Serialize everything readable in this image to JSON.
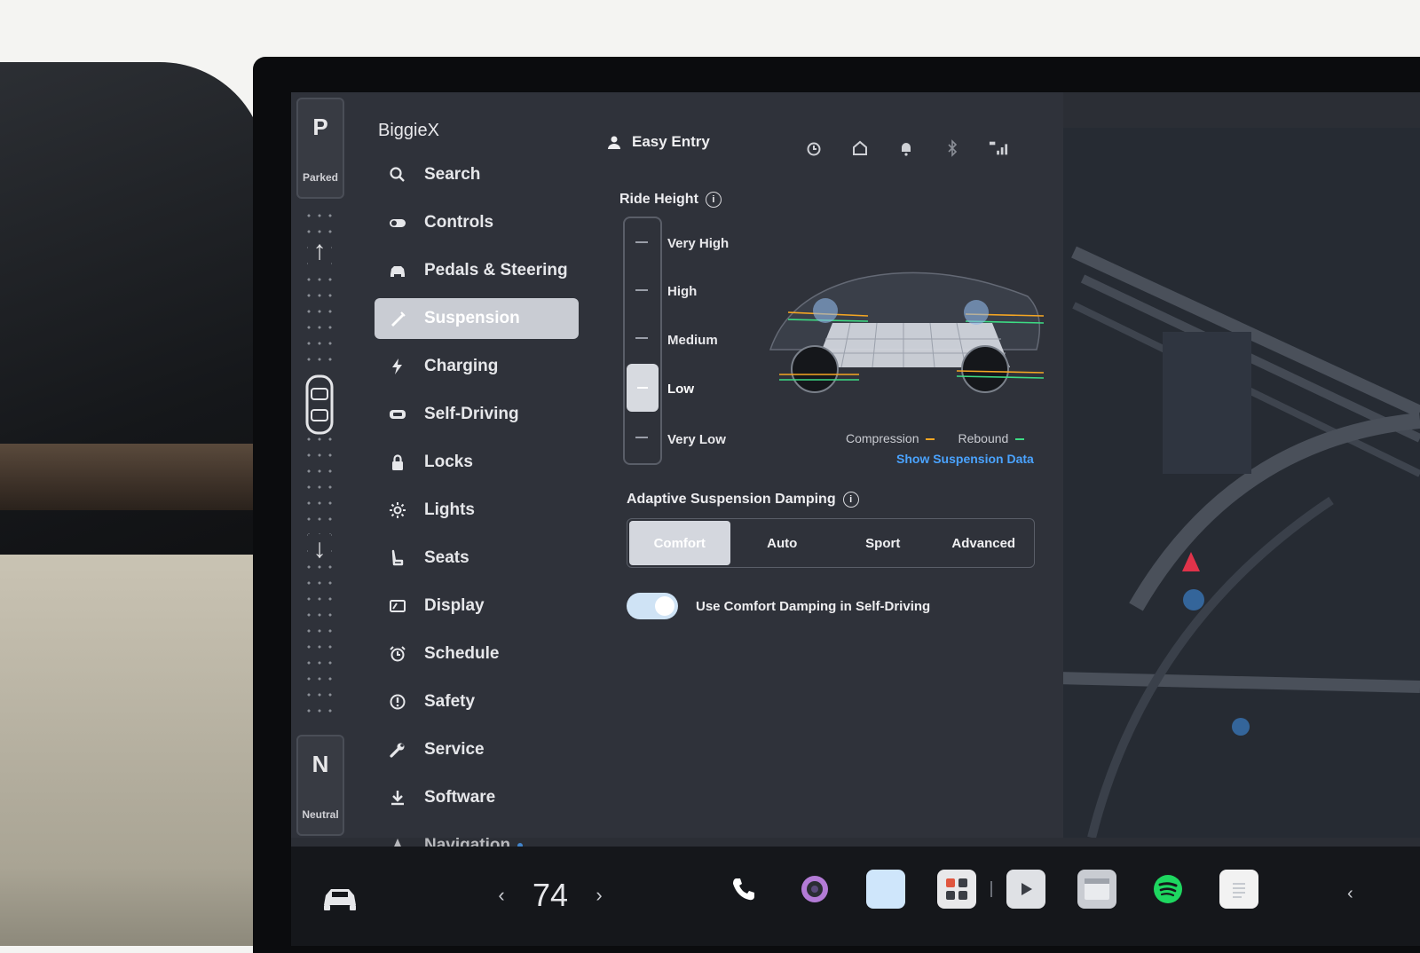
{
  "gear": {
    "park_letter": "P",
    "park_label": "Parked",
    "neutral_letter": "N",
    "neutral_label": "Neutral"
  },
  "profile": {
    "name": "BiggieX",
    "header_profile": "Easy Entry"
  },
  "nav": {
    "items": [
      {
        "label": "Search",
        "icon": "search-icon"
      },
      {
        "label": "Controls",
        "icon": "toggle-icon"
      },
      {
        "label": "Pedals & Steering",
        "icon": "car-icon"
      },
      {
        "label": "Suspension",
        "icon": "suspension-icon",
        "active": true
      },
      {
        "label": "Charging",
        "icon": "lightning-icon"
      },
      {
        "label": "Self-Driving",
        "icon": "steering-wheel-icon"
      },
      {
        "label": "Locks",
        "icon": "lock-icon"
      },
      {
        "label": "Lights",
        "icon": "sun-icon"
      },
      {
        "label": "Seats",
        "icon": "seat-icon"
      },
      {
        "label": "Display",
        "icon": "display-icon"
      },
      {
        "label": "Schedule",
        "icon": "alarm-icon"
      },
      {
        "label": "Safety",
        "icon": "alert-icon"
      },
      {
        "label": "Service",
        "icon": "wrench-icon"
      },
      {
        "label": "Software",
        "icon": "download-icon"
      },
      {
        "label": "Navigation",
        "icon": "navigation-arrow-icon"
      }
    ]
  },
  "header": {
    "status_icons": [
      "alarm-icon",
      "home-icon",
      "bell-icon",
      "bluetooth-icon",
      "lte-signal-icon"
    ]
  },
  "ride_height": {
    "title": "Ride Height",
    "levels": [
      "Very High",
      "High",
      "Medium",
      "Low",
      "Very Low"
    ],
    "selected": "Low",
    "legend_compression": "Compression",
    "legend_rebound": "Rebound",
    "compression_color": "#f5a623",
    "rebound_color": "#3ddc84",
    "link": "Show Suspension Data"
  },
  "damping": {
    "title": "Adaptive Suspension Damping",
    "options": [
      "Comfort",
      "Auto",
      "Sport",
      "Advanced"
    ],
    "selected": "Comfort",
    "toggle_label": "Use Comfort Damping in Self-Driving",
    "toggle_on": true
  },
  "bottom_bar": {
    "temperature": "74",
    "temp_left": "‹",
    "temp_right": "›",
    "apps": [
      "phone-icon",
      "camera-icon",
      "app-tile-icon",
      "toybox-icon",
      "theater-icon",
      "browser-icon",
      "spotify-icon",
      "notepad-icon"
    ],
    "right_chevron": "‹"
  },
  "colors": {
    "accent": "#4aa3ff",
    "panel": "#2f323a",
    "active_tab": "#c9ccd3"
  }
}
